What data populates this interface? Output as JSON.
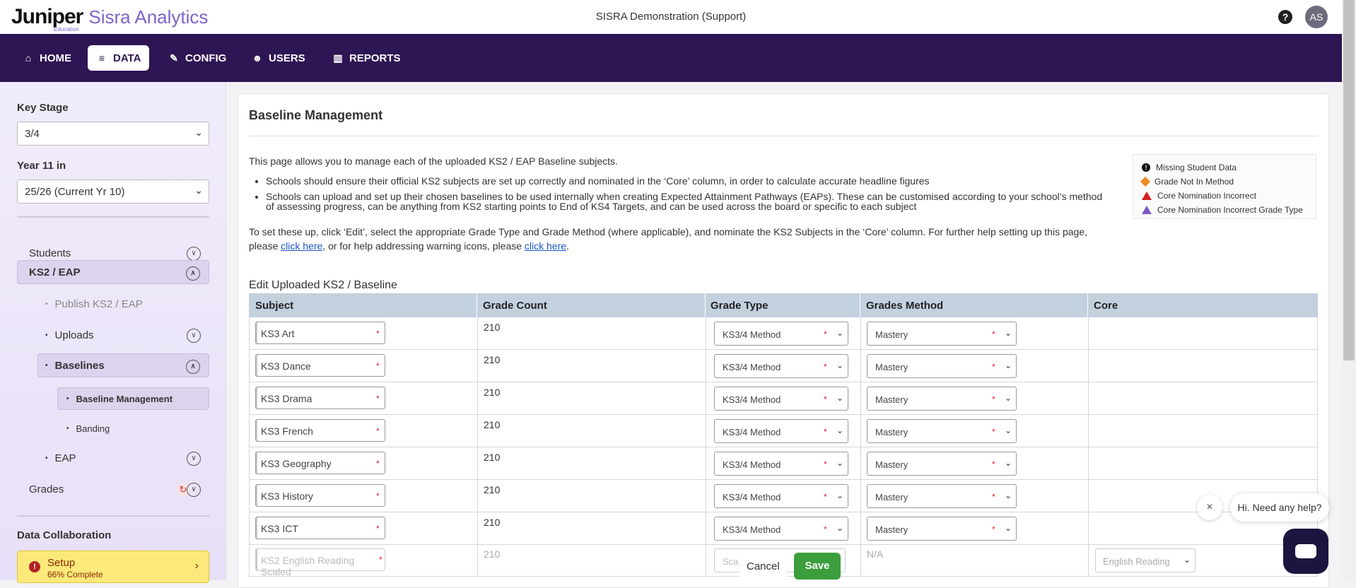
{
  "header": {
    "logo_main": "Juniper",
    "logo_sub": "Education",
    "logo_product": "Sisra Analytics",
    "organisation": "SISRA Demonstration (Support)",
    "help_icon": "?",
    "avatar_initials": "AS"
  },
  "nav": {
    "items": [
      {
        "label": "HOME",
        "icon": "home-icon"
      },
      {
        "label": "DATA",
        "icon": "database-icon"
      },
      {
        "label": "CONFIG",
        "icon": "wrench-icon"
      },
      {
        "label": "USERS",
        "icon": "users-icon"
      },
      {
        "label": "REPORTS",
        "icon": "chart-icon"
      }
    ],
    "active": "DATA"
  },
  "sidebar": {
    "key_stage_label": "Key Stage",
    "key_stage_value": "3/4",
    "year_label": "Year 11 in",
    "year_value": "25/26 (Current Yr 10)",
    "items": [
      {
        "label": "Students"
      },
      {
        "label": "KS2 / EAP"
      },
      {
        "label": "Publish KS2 / EAP"
      },
      {
        "label": "Uploads"
      },
      {
        "label": "Baselines"
      },
      {
        "label": "Baseline Management"
      },
      {
        "label": "Banding"
      },
      {
        "label": "EAP"
      },
      {
        "label": "Grades"
      }
    ],
    "collab_label": "Data Collaboration",
    "setup": {
      "title": "Setup",
      "subtitle": "66% Complete",
      "progress_percent": 66
    }
  },
  "main": {
    "title": "Baseline Management",
    "intro": "This page allows you to manage each of the uploaded KS2 / EAP Baseline subjects.",
    "bullets": [
      "Schools should ensure their official KS2 subjects are set up correctly and nominated in the ‘Core’ column, in order to calculate accurate headline figures",
      "Schools can upload and set up their chosen baselines to be used internally when creating Expected Attainment Pathways (EAPs). These can be customised according to your school’s method of assessing progress, can be anything from KS2 starting points to End of KS4 Targets, and can be used across the board or specific to each subject"
    ],
    "setup_text_1": "To set these up, click ‘Edit’, select the appropriate Grade Type and Grade Method (where applicable), and nominate the KS2 Subjects in the ‘Core’ column. For further help setting up this page, please ",
    "link_1": "click here",
    "setup_text_2": ", or for help addressing warning icons, please ",
    "link_2": "click here",
    "setup_text_3": ".",
    "legend": [
      {
        "label": "Missing Student Data",
        "icon": "missing-data-icon",
        "color": "#111111"
      },
      {
        "label": "Grade Not In Method",
        "icon": "not-in-method-icon",
        "color": "#f18b22"
      },
      {
        "label": "Core Nomination Incorrect",
        "icon": "warning-triangle-red-icon",
        "color": "#d0241d"
      },
      {
        "label": "Core Nomination Incorrect Grade Type",
        "icon": "warning-triangle-purple-icon",
        "color": "#7e56c7"
      }
    ],
    "table_title": "Edit Uploaded KS2 / Baseline",
    "columns": [
      "Subject",
      "Grade Count",
      "Grade Type",
      "Grades Method",
      "Core"
    ],
    "rows": [
      {
        "subject": "KS3 Art",
        "count": "210",
        "grade_type": "KS3/4 Method",
        "method": "Mastery"
      },
      {
        "subject": "KS3 Dance",
        "count": "210",
        "grade_type": "KS3/4 Method",
        "method": "Mastery"
      },
      {
        "subject": "KS3 Drama",
        "count": "210",
        "grade_type": "KS3/4 Method",
        "method": "Mastery"
      },
      {
        "subject": "KS3 French",
        "count": "210",
        "grade_type": "KS3/4 Method",
        "method": "Mastery"
      },
      {
        "subject": "KS3 Geography",
        "count": "210",
        "grade_type": "KS3/4 Method",
        "method": "Mastery"
      },
      {
        "subject": "KS3 History",
        "count": "210",
        "grade_type": "KS3/4 Method",
        "method": "Mastery"
      },
      {
        "subject": "KS3 ICT",
        "count": "210",
        "grade_type": "KS3/4 Method",
        "method": "Mastery"
      }
    ],
    "last_row": {
      "subject": "KS2 English Reading Scaled",
      "count": "210",
      "grade_type": "Sca",
      "method": "N/A",
      "core": "English Reading"
    },
    "cancel_label": "Cancel",
    "save_label": "Save"
  },
  "chat": {
    "bubble_text": "Hi. Need any help?",
    "close_icon": "×"
  }
}
